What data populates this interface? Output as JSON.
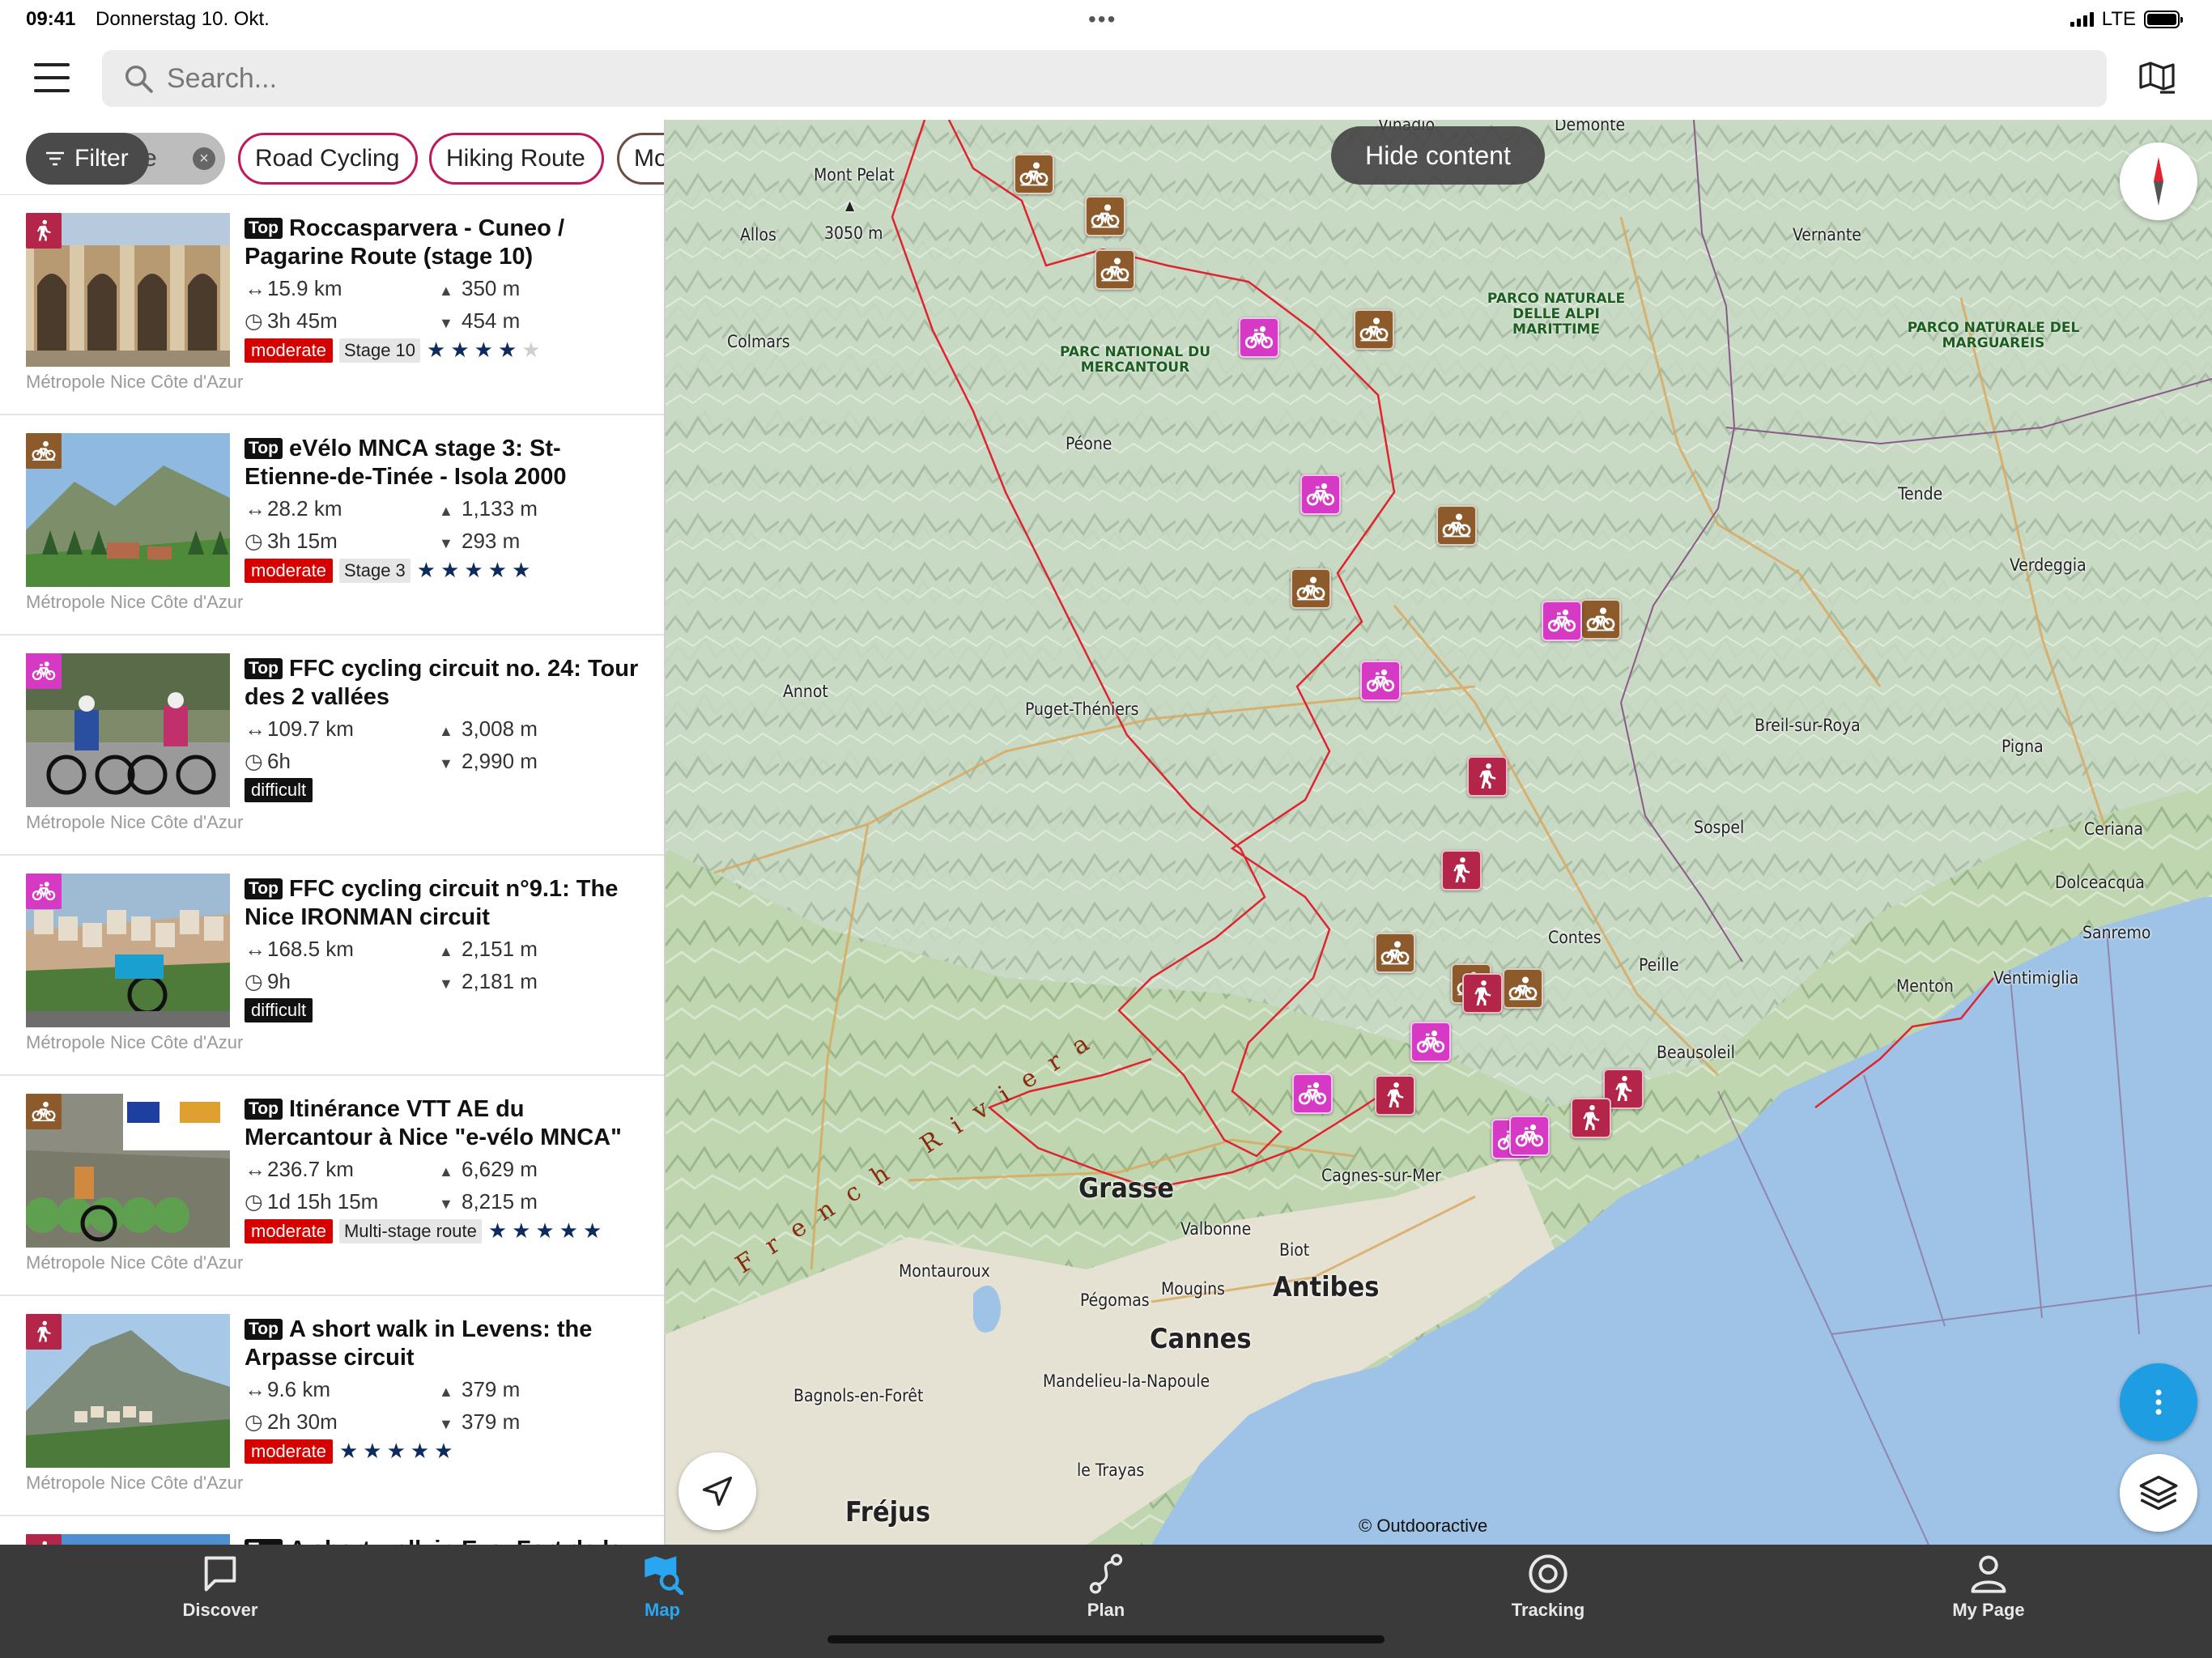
{
  "status_bar": {
    "time": "09:41",
    "date": "Donnerstag 10. Okt.",
    "network": "LTE"
  },
  "search": {
    "placeholder": "Search..."
  },
  "filters": {
    "filter_label": "Filter",
    "hidden_chip_text": "ute",
    "chips": [
      "Road Cycling",
      "Hiking Route",
      "Mo"
    ]
  },
  "list": [
    {
      "type": "hike",
      "title": "Roccasparvera - Cuneo / Pagarine Route (stage 10)",
      "tag": "Top",
      "distance": "15.9 km",
      "duration": "3h 45m",
      "ascent": "350 m",
      "descent": "454 m",
      "difficulty": "moderate",
      "stage": "Stage 10",
      "stars": 4,
      "region": "Métropole Nice Côte d'Azur"
    },
    {
      "type": "mtb",
      "title": "eVélo MNCA stage 3: St-Etienne-de-Tinée - Isola 2000",
      "tag": "Top",
      "distance": "28.2 km",
      "duration": "3h 15m",
      "ascent": "1,133 m",
      "descent": "293 m",
      "difficulty": "moderate",
      "stage": "Stage 3",
      "stars": 5,
      "region": "Métropole Nice Côte d'Azur"
    },
    {
      "type": "road",
      "title": "FFC cycling circuit no. 24: Tour des 2 vallées",
      "tag": "Top",
      "distance": "109.7 km",
      "duration": "6h",
      "ascent": "3,008 m",
      "descent": "2,990 m",
      "difficulty": "difficult",
      "stage": "",
      "stars": 0,
      "region": "Métropole Nice Côte d'Azur"
    },
    {
      "type": "road",
      "title": "FFC cycling circuit n°9.1: The Nice IRONMAN circuit",
      "tag": "Top",
      "distance": "168.5 km",
      "duration": "9h",
      "ascent": "2,151 m",
      "descent": "2,181 m",
      "difficulty": "difficult",
      "stage": "",
      "stars": 0,
      "region": "Métropole Nice Côte d'Azur"
    },
    {
      "type": "mtb",
      "title": "Itinérance VTT AE du Mercantour à Nice \"e-vélo MNCA\"",
      "tag": "Top",
      "distance": "236.7 km",
      "duration": "1d 15h 15m",
      "ascent": "6,629 m",
      "descent": "8,215 m",
      "difficulty": "moderate",
      "stage": "Multi-stage route",
      "stars": 5,
      "region": "Métropole Nice Côte d'Azur"
    },
    {
      "type": "hike",
      "title": "A short walk in Levens: the Arpasse circuit",
      "tag": "Top",
      "distance": "9.6 km",
      "duration": "2h 30m",
      "ascent": "379 m",
      "descent": "379 m",
      "difficulty": "moderate",
      "stage": "",
      "stars": 5,
      "region": "Métropole Nice Côte d'Azur"
    },
    {
      "type": "hike",
      "title": "A short walk in Eze: Fort de la",
      "tag": "Top",
      "distance": "",
      "duration": "",
      "ascent": "",
      "descent": "",
      "difficulty": "",
      "stage": "",
      "stars": 0,
      "region": ""
    }
  ],
  "map": {
    "hide_button": "Hide content",
    "credit": "© Outdooractive",
    "parks": [
      "PARCO NATURALE DELLE ALPI MARITTIME",
      "PARC NATIONAL DU MERCANTOUR",
      "PARCO NATURALE DEL MARGUAREIS"
    ],
    "region_label": "French Riviera",
    "peak": {
      "name": "Mont Pelat",
      "elevation": "3050 m"
    },
    "places": [
      "Vinadio",
      "Demonte",
      "Allos",
      "Vernante",
      "Colmars",
      "Péone",
      "Tende",
      "Verdeggia",
      "Annot",
      "Puget-Théniers",
      "Breil-sur-Roya",
      "Pigna",
      "Sospel",
      "Ceriana",
      "Dolceacqua",
      "Contes",
      "Peille",
      "Sanremo",
      "Menton",
      "Ventimiglia",
      "Beausoleil",
      "Cagnes-sur-Mer",
      "Valbonne",
      "Biot",
      "Montauroux",
      "Pégomas",
      "Mougins",
      "Bagnols-en-Forêt",
      "Mandelieu-la-Napoule",
      "le Trayas"
    ],
    "major_places": [
      "Grasse",
      "Antibes",
      "Cannes",
      "Fréjus"
    ]
  },
  "tabs": [
    {
      "label": "Discover",
      "icon": "chat-bubble-icon",
      "active": false
    },
    {
      "label": "Map",
      "icon": "map-search-icon",
      "active": true
    },
    {
      "label": "Plan",
      "icon": "route-plan-icon",
      "active": false
    },
    {
      "label": "Tracking",
      "icon": "record-icon",
      "active": false
    },
    {
      "label": "My Page",
      "icon": "person-icon",
      "active": false
    }
  ],
  "colors": {
    "mtb": "#8d5a2b",
    "road": "#d63ac4",
    "hike": "#b3264a",
    "accent": "#2aa6f0",
    "moderate": "#d50000"
  }
}
